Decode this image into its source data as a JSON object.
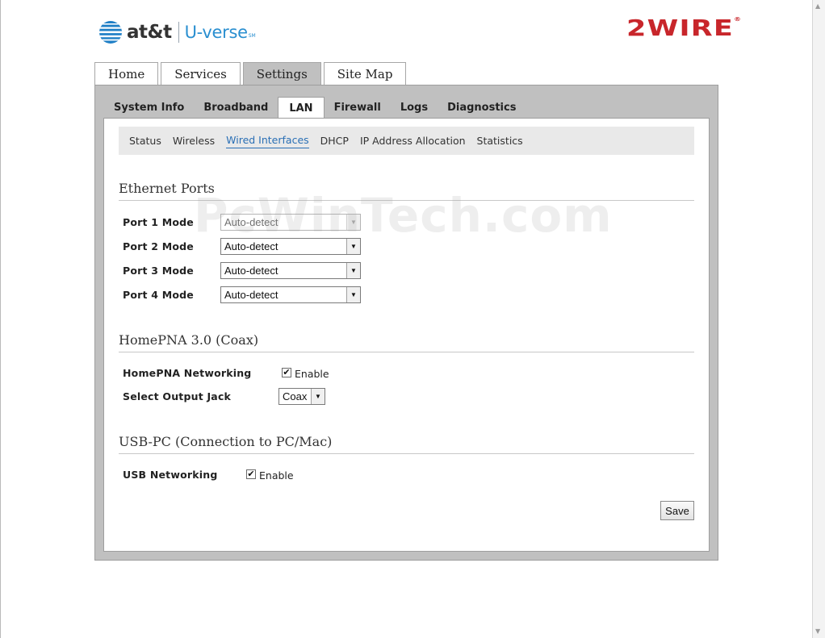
{
  "header": {
    "att_text": "at&t",
    "uverse_text": "U-verse",
    "uverse_tm": "SM",
    "brand_text": "2WIRE",
    "brand_reg": "®"
  },
  "top_tabs": [
    {
      "label": "Home",
      "active": false
    },
    {
      "label": "Services",
      "active": false
    },
    {
      "label": "Settings",
      "active": true
    },
    {
      "label": "Site Map",
      "active": false
    }
  ],
  "sub_tabs": [
    {
      "label": "System Info",
      "active": false
    },
    {
      "label": "Broadband",
      "active": false
    },
    {
      "label": "LAN",
      "active": true
    },
    {
      "label": "Firewall",
      "active": false
    },
    {
      "label": "Logs",
      "active": false
    },
    {
      "label": "Diagnostics",
      "active": false
    }
  ],
  "subnav": [
    {
      "label": "Status",
      "active": false
    },
    {
      "label": "Wireless",
      "active": false
    },
    {
      "label": "Wired Interfaces",
      "active": true
    },
    {
      "label": "DHCP",
      "active": false
    },
    {
      "label": "IP Address Allocation",
      "active": false
    },
    {
      "label": "Statistics",
      "active": false
    }
  ],
  "ethernet": {
    "title": "Ethernet Ports",
    "ports": [
      {
        "label": "Port 1 Mode",
        "value": "Auto-detect",
        "disabled": true
      },
      {
        "label": "Port 2 Mode",
        "value": "Auto-detect",
        "disabled": false
      },
      {
        "label": "Port 3 Mode",
        "value": "Auto-detect",
        "disabled": false
      },
      {
        "label": "Port 4 Mode",
        "value": "Auto-detect",
        "disabled": false
      }
    ]
  },
  "homepna": {
    "title": "HomePNA 3.0 (Coax)",
    "networking_label": "HomePNA Networking",
    "networking_checked": true,
    "networking_cb_label": "Enable",
    "jack_label": "Select Output Jack",
    "jack_value": "Coax"
  },
  "usb": {
    "title": "USB-PC (Connection to PC/Mac)",
    "networking_label": "USB Networking",
    "networking_checked": true,
    "networking_cb_label": "Enable"
  },
  "save_label": "Save",
  "watermark": "PcWinTech.com",
  "colors": {
    "link_active": "#2a6fb5",
    "brand_red": "#c8262b",
    "uverse_blue": "#2a8fd0",
    "panel_gray": "#c0c0c0"
  },
  "icons": {
    "select_arrow": "chevron-down-icon",
    "checkbox_mark": "check-icon",
    "att_globe": "att-globe-icon"
  }
}
